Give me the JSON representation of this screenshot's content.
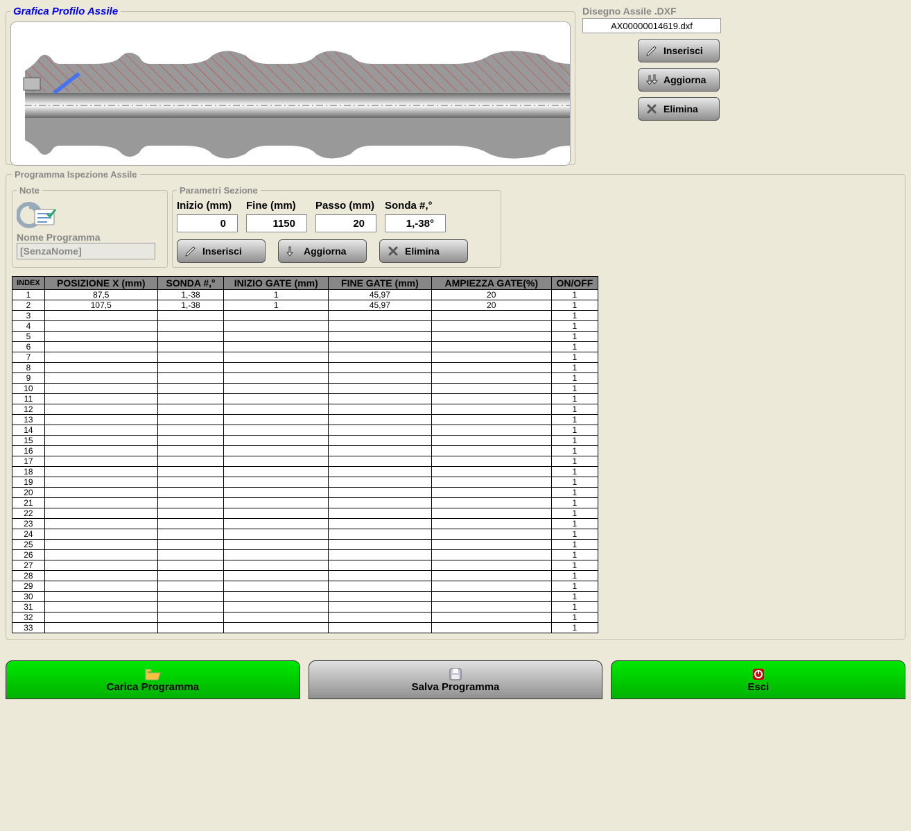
{
  "groups": {
    "profile": "Grafica Profilo Assile",
    "dxf": "Disegno Assile .DXF",
    "program": "Programma Ispezione Assile",
    "note": "Note",
    "params": "Parametri Sezione"
  },
  "dxf": {
    "filename": "AX00000014619.dxf"
  },
  "buttons": {
    "inserisci": "Inserisci",
    "aggiorna": "Aggiorna",
    "elimina": "Elimina"
  },
  "note": {
    "nome_label": "Nome Programma",
    "nome_value": "[SenzaNome]"
  },
  "params": {
    "labels": {
      "inizio": "Inizio (mm)",
      "fine": "Fine (mm)",
      "passo": "Passo (mm)",
      "sonda": "Sonda #,°"
    },
    "values": {
      "inizio": "0",
      "fine": "1150",
      "passo": "20",
      "sonda": "1,-38°"
    }
  },
  "table": {
    "headers": [
      "INDEX",
      "POSIZIONE X (mm)",
      "SONDA #,°",
      "INIZIO GATE (mm)",
      "FINE GATE (mm)",
      "AMPIEZZA GATE(%)",
      "ON/OFF"
    ],
    "rows": [
      {
        "i": "1",
        "px": "87,5",
        "sonda": "1,-38",
        "ig": "1",
        "fg": "45,97",
        "amp": "20",
        "oo": "1"
      },
      {
        "i": "2",
        "px": "107,5",
        "sonda": "1,-38",
        "ig": "1",
        "fg": "45,97",
        "amp": "20",
        "oo": "1"
      },
      {
        "i": "3",
        "px": "",
        "sonda": "",
        "ig": "",
        "fg": "",
        "amp": "",
        "oo": "1"
      },
      {
        "i": "4",
        "px": "",
        "sonda": "",
        "ig": "",
        "fg": "",
        "amp": "",
        "oo": "1"
      },
      {
        "i": "5",
        "px": "",
        "sonda": "",
        "ig": "",
        "fg": "",
        "amp": "",
        "oo": "1"
      },
      {
        "i": "6",
        "px": "",
        "sonda": "",
        "ig": "",
        "fg": "",
        "amp": "",
        "oo": "1"
      },
      {
        "i": "7",
        "px": "",
        "sonda": "",
        "ig": "",
        "fg": "",
        "amp": "",
        "oo": "1"
      },
      {
        "i": "8",
        "px": "",
        "sonda": "",
        "ig": "",
        "fg": "",
        "amp": "",
        "oo": "1"
      },
      {
        "i": "9",
        "px": "",
        "sonda": "",
        "ig": "",
        "fg": "",
        "amp": "",
        "oo": "1"
      },
      {
        "i": "10",
        "px": "",
        "sonda": "",
        "ig": "",
        "fg": "",
        "amp": "",
        "oo": "1"
      },
      {
        "i": "11",
        "px": "",
        "sonda": "",
        "ig": "",
        "fg": "",
        "amp": "",
        "oo": "1"
      },
      {
        "i": "12",
        "px": "",
        "sonda": "",
        "ig": "",
        "fg": "",
        "amp": "",
        "oo": "1"
      },
      {
        "i": "13",
        "px": "",
        "sonda": "",
        "ig": "",
        "fg": "",
        "amp": "",
        "oo": "1"
      },
      {
        "i": "14",
        "px": "",
        "sonda": "",
        "ig": "",
        "fg": "",
        "amp": "",
        "oo": "1"
      },
      {
        "i": "15",
        "px": "",
        "sonda": "",
        "ig": "",
        "fg": "",
        "amp": "",
        "oo": "1"
      },
      {
        "i": "16",
        "px": "",
        "sonda": "",
        "ig": "",
        "fg": "",
        "amp": "",
        "oo": "1"
      },
      {
        "i": "17",
        "px": "",
        "sonda": "",
        "ig": "",
        "fg": "",
        "amp": "",
        "oo": "1"
      },
      {
        "i": "18",
        "px": "",
        "sonda": "",
        "ig": "",
        "fg": "",
        "amp": "",
        "oo": "1"
      },
      {
        "i": "19",
        "px": "",
        "sonda": "",
        "ig": "",
        "fg": "",
        "amp": "",
        "oo": "1"
      },
      {
        "i": "20",
        "px": "",
        "sonda": "",
        "ig": "",
        "fg": "",
        "amp": "",
        "oo": "1"
      },
      {
        "i": "21",
        "px": "",
        "sonda": "",
        "ig": "",
        "fg": "",
        "amp": "",
        "oo": "1"
      },
      {
        "i": "22",
        "px": "",
        "sonda": "",
        "ig": "",
        "fg": "",
        "amp": "",
        "oo": "1"
      },
      {
        "i": "23",
        "px": "",
        "sonda": "",
        "ig": "",
        "fg": "",
        "amp": "",
        "oo": "1"
      },
      {
        "i": "24",
        "px": "",
        "sonda": "",
        "ig": "",
        "fg": "",
        "amp": "",
        "oo": "1"
      },
      {
        "i": "25",
        "px": "",
        "sonda": "",
        "ig": "",
        "fg": "",
        "amp": "",
        "oo": "1"
      },
      {
        "i": "26",
        "px": "",
        "sonda": "",
        "ig": "",
        "fg": "",
        "amp": "",
        "oo": "1"
      },
      {
        "i": "27",
        "px": "",
        "sonda": "",
        "ig": "",
        "fg": "",
        "amp": "",
        "oo": "1"
      },
      {
        "i": "28",
        "px": "",
        "sonda": "",
        "ig": "",
        "fg": "",
        "amp": "",
        "oo": "1"
      },
      {
        "i": "29",
        "px": "",
        "sonda": "",
        "ig": "",
        "fg": "",
        "amp": "",
        "oo": "1"
      },
      {
        "i": "30",
        "px": "",
        "sonda": "",
        "ig": "",
        "fg": "",
        "amp": "",
        "oo": "1"
      },
      {
        "i": "31",
        "px": "",
        "sonda": "",
        "ig": "",
        "fg": "",
        "amp": "",
        "oo": "1"
      },
      {
        "i": "32",
        "px": "",
        "sonda": "",
        "ig": "",
        "fg": "",
        "amp": "",
        "oo": "1"
      },
      {
        "i": "33",
        "px": "",
        "sonda": "",
        "ig": "",
        "fg": "",
        "amp": "",
        "oo": "1"
      }
    ]
  },
  "footer": {
    "carica": "Carica Programma",
    "salva": "Salva Programma",
    "esci": "Esci"
  }
}
